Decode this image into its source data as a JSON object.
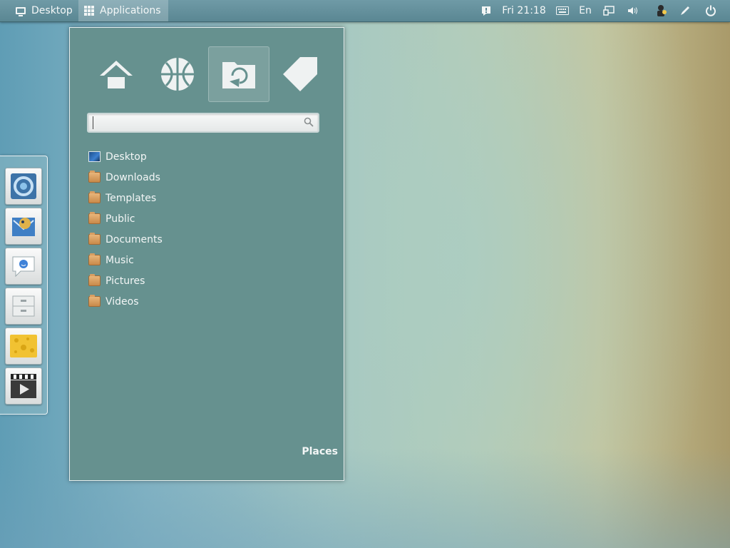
{
  "panel": {
    "desktop_label": "Desktop",
    "applications_label": "Applications",
    "clock": "Fri 21:18",
    "keyboard_layout": "En"
  },
  "dock": {
    "items": [
      "chromium-icon",
      "thunderbird-icon",
      "chat-icon",
      "file-cabinet-icon",
      "cheese-icon",
      "video-player-icon"
    ]
  },
  "menu": {
    "title": "Places",
    "categories": [
      "home-icon",
      "network-icon",
      "folder-sync-icon",
      "tag-icon"
    ],
    "active_category": 2,
    "search": {
      "value": "",
      "placeholder": ""
    },
    "places": [
      "Desktop",
      "Downloads",
      "Templates",
      "Public",
      "Documents",
      "Music",
      "Pictures",
      "Videos"
    ]
  },
  "colors": {
    "panel": "#5f8e99",
    "menu_background": "#66918f",
    "folder": "#d79a5c"
  }
}
